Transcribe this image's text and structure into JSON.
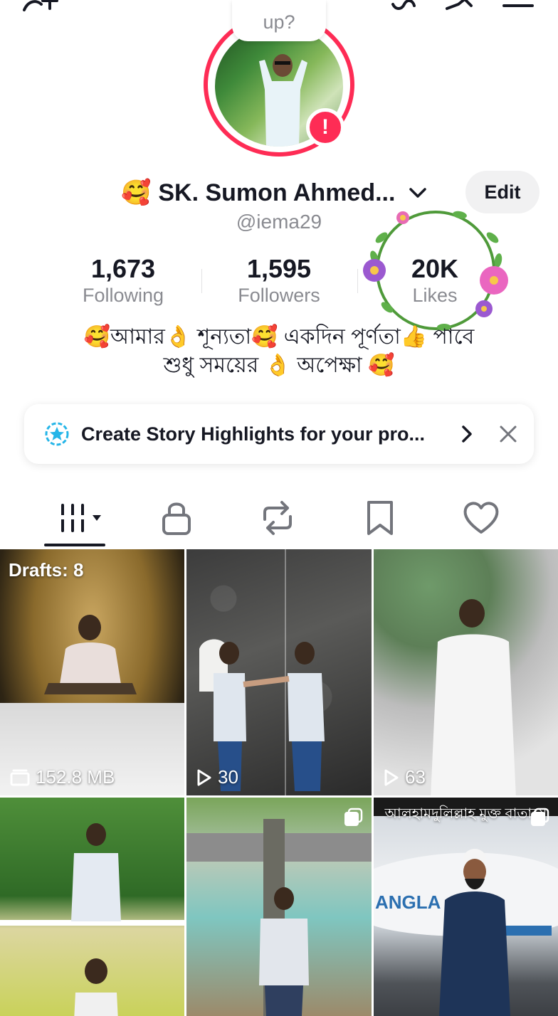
{
  "profile": {
    "status_bubble": "up?",
    "name_emoji": "🥰",
    "display_name": "SK. Sumon Ahmed...",
    "username": "@iema29",
    "edit_label": "Edit"
  },
  "stats": {
    "following": {
      "value": "1,673",
      "label": "Following"
    },
    "followers": {
      "value": "1,595",
      "label": "Followers"
    },
    "likes": {
      "value": "20K",
      "label": "Likes"
    }
  },
  "bio": {
    "line1": "🥰আমার👌 শূন্যতা🥰 একদিন পূর্ণতা👍 পাবে",
    "line2": "শুধু সময়ের 👌 অপেক্ষা 🥰"
  },
  "banner": {
    "text": "Create Story Highlights for your pro..."
  },
  "tabs": [
    {
      "name": "videos",
      "icon": "grid-icon"
    },
    {
      "name": "private",
      "icon": "lock-icon"
    },
    {
      "name": "reposts",
      "icon": "repost-icon"
    },
    {
      "name": "favorites",
      "icon": "bookmark-icon"
    },
    {
      "name": "liked",
      "icon": "heart-icon"
    }
  ],
  "grid": {
    "drafts_label": "Drafts: 8",
    "drafts_size": "152.8 MB",
    "video2_views": "30",
    "video3_views": "63",
    "video6_caption": "আলহামদুলিল্লাহ মুক্ত বাতাসে"
  },
  "colors": {
    "accent": "#fe2c55",
    "text_primary": "#161823",
    "text_secondary": "#8a8b91"
  }
}
